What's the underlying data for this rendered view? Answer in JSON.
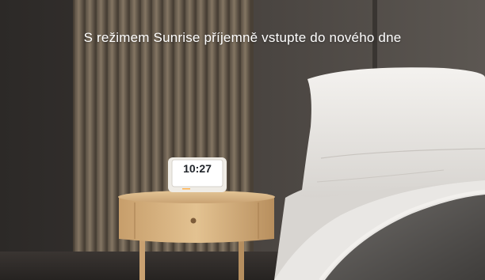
{
  "headline": "S režimem Sunrise příjemně vstupte do nového dne",
  "clock": {
    "time": "10:27"
  },
  "colors": {
    "headline_text": "#ffffff",
    "wall": "#3a3633",
    "wood_panels": "#8a7a66",
    "nightstand": "#d9b684",
    "bed_linen": "#e9e7e4"
  }
}
